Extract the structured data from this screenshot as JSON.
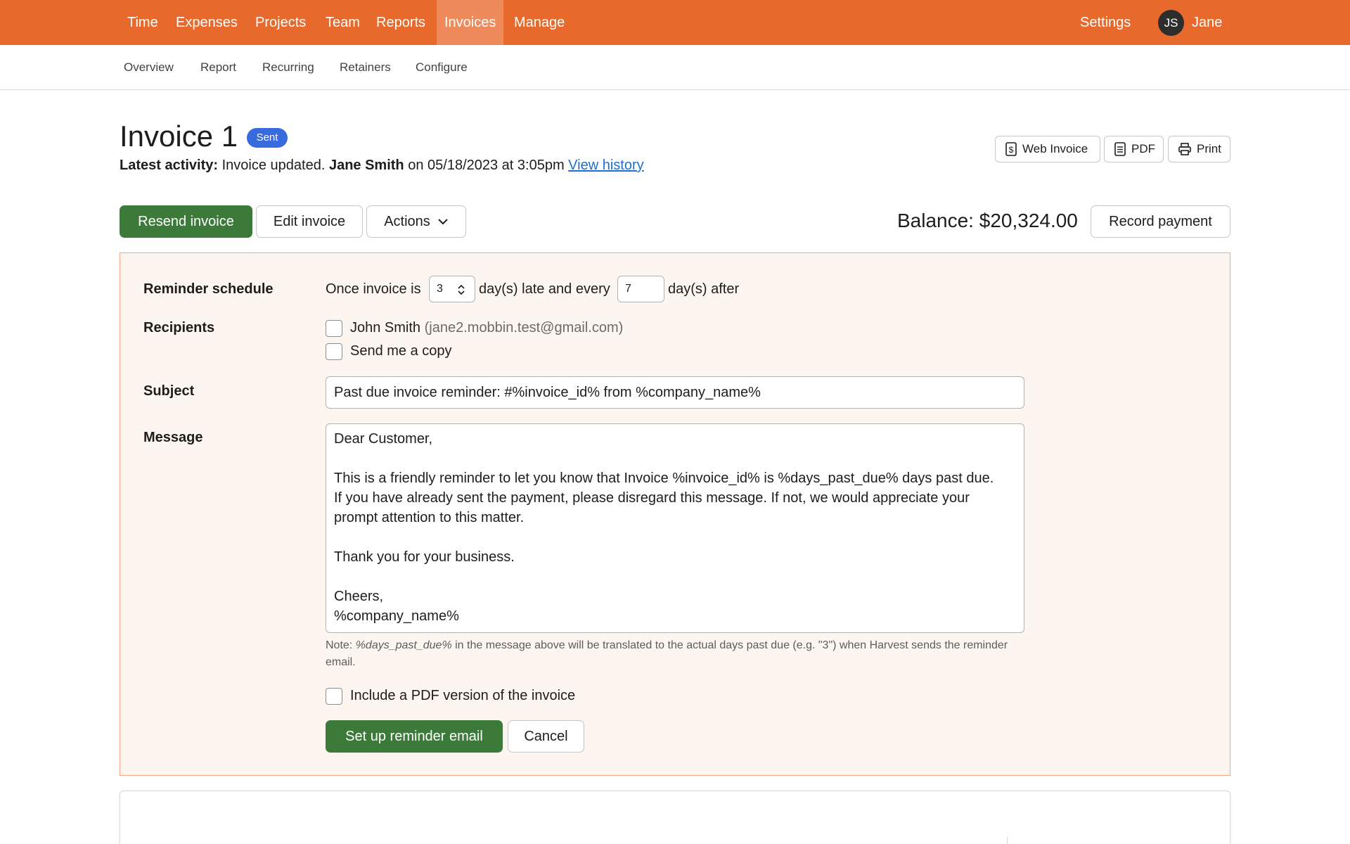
{
  "topnav": {
    "items": [
      "Time",
      "Expenses",
      "Projects",
      "Team",
      "Reports",
      "Invoices",
      "Manage"
    ],
    "active": "Invoices",
    "settings": "Settings",
    "avatar_initials": "JS",
    "username": "Jane",
    "bg_color": "#e8692c"
  },
  "subnav": {
    "items": [
      "Overview",
      "Report",
      "Recurring",
      "Retainers",
      "Configure"
    ]
  },
  "header": {
    "title": "Invoice 1",
    "status_badge": "Sent",
    "activity_label": "Latest activity:",
    "activity_text": " Invoice updated. ",
    "activity_user": "Jane Smith",
    "activity_when": " on 05/18/2023 at 3:05pm ",
    "view_history": "View history",
    "web_invoice": "Web Invoice",
    "pdf": "PDF",
    "print": "Print"
  },
  "actions": {
    "resend": "Resend invoice",
    "edit": "Edit invoice",
    "actions": "Actions",
    "balance": "Balance: $20,324.00",
    "record_payment": "Record payment"
  },
  "reminder": {
    "schedule_label": "Reminder schedule",
    "once_text": "Once invoice is",
    "days_late_value": "3",
    "late_text": "day(s) late and every",
    "every_value": "7",
    "after_text": "day(s) after",
    "recipients_label": "Recipients",
    "recipient_name": "John Smith",
    "recipient_email": "(jane2.mobbin.test@gmail.com)",
    "send_copy": "Send me a copy",
    "subject_label": "Subject",
    "subject_value": "Past due invoice reminder: #%invoice_id% from %company_name%",
    "message_label": "Message",
    "message_lines": [
      "Dear Customer,",
      "This is a friendly reminder to let you know that Invoice %invoice_id% is %days_past_due% days past due.",
      "If you have already sent the payment, please disregard this message. If not, we would appreciate your",
      "prompt attention to this matter.",
      "Thank you for your business.",
      "Cheers,",
      "%company_name%"
    ],
    "note_prefix": "Note: ",
    "note_var": "%days_past_due%",
    "note_text": " in the message above will be translated to the actual days past due (e.g. \"3\") when Harvest sends the reminder email.",
    "include_pdf": "Include a PDF version of the invoice",
    "setup_button": "Set up reminder email",
    "cancel_button": "Cancel"
  },
  "colors": {
    "primary_green": "#3c7a3a",
    "badge_blue": "#376bdd",
    "panel_bg": "#fdf6f0",
    "panel_border": "#f0a886"
  }
}
